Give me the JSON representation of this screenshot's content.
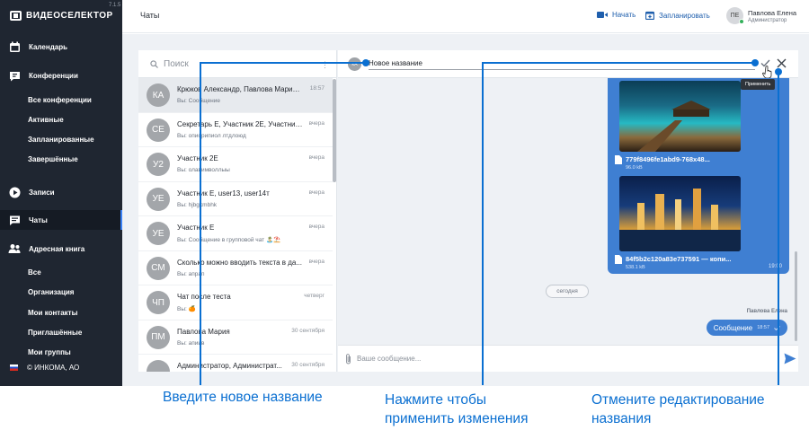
{
  "app": {
    "logo_text": "ВИДЕОСЕЛЕКТОР",
    "version": "7.1.5",
    "copyright": "© ИНКОМА, АО"
  },
  "sidebar": {
    "sections": [
      {
        "label": "Календарь",
        "icon": "calendar-icon"
      },
      {
        "label": "Конференции",
        "icon": "conference-icon"
      },
      {
        "label": "Записи",
        "icon": "play-icon"
      },
      {
        "label": "Чаты",
        "icon": "chat-icon",
        "active": true
      },
      {
        "label": "Адресная книга",
        "icon": "contacts-icon"
      }
    ],
    "conference_items": [
      "Все конференции",
      "Активные",
      "Запланированные",
      "Завершённые"
    ],
    "addressbook_items": [
      "Все",
      "Организация",
      "Мои контакты",
      "Приглашённые",
      "Мои группы"
    ]
  },
  "header": {
    "title": "Чаты",
    "start_label": "Начать",
    "schedule_label": "Запланировать",
    "user_initials": "ПЕ",
    "user_name": "Павлова Елена",
    "user_role": "Администратор"
  },
  "chat_list": {
    "search_placeholder": "Поиск",
    "items": [
      {
        "initials": "КА",
        "name": "Крюков Александр, Павлова Мария, ...",
        "time": "18:57",
        "preview": "Вы: Сообщение",
        "selected": true
      },
      {
        "initials": "СЕ",
        "name": "Секретарь Е, Участник 2Е, Участник ...",
        "time": "вчера",
        "preview": "Вы: опиорипиол лтдлоюд"
      },
      {
        "initials": "У2",
        "name": "Участник 2Е",
        "time": "вчера",
        "preview": "Вы: олавимволлыы"
      },
      {
        "initials": "УЕ",
        "name": "Участник Е, user13, user14т",
        "time": "вчера",
        "preview": "Вы: hjbgkmbhk"
      },
      {
        "initials": "УЕ",
        "name": "Участник Е",
        "time": "вчера",
        "preview": "Вы: Сообщение в групповой чат 🏝️⛱️"
      },
      {
        "initials": "СМ",
        "name": "Сколько можно вводить текста в да...",
        "time": "вчера",
        "preview": "Вы: апрап"
      },
      {
        "initials": "ЧП",
        "name": "Чат после теста",
        "time": "четверг",
        "preview": "Вы: 🍊"
      },
      {
        "initials": "ПМ",
        "name": "Павлова Мария",
        "time": "30 сентября",
        "preview": "Вы: апиив"
      },
      {
        "initials": "",
        "name": "Администратор, Администрат...",
        "time": "30 сентября",
        "preview": ""
      }
    ]
  },
  "chat": {
    "avatar_initials": "КА",
    "name_value": "Новое название",
    "apply_tooltip": "Применить",
    "files": [
      {
        "name": "779f8496fe1abd9-768x48...",
        "size": "96.0 kB"
      },
      {
        "name": "84f5b2c120a83e737591 — копи...",
        "size": "538.1 kB"
      }
    ],
    "image_time": "19:00",
    "day_label": "сегодня",
    "sender": "Павлова Елена",
    "last_message": "Сообщение",
    "last_time": "18:57",
    "composer_placeholder": "Ваше сообщение..."
  },
  "callouts": {
    "new_name": "Введите новое название",
    "apply_line1": "Нажмите чтобы",
    "apply_line2": "применить изменения",
    "cancel_line1": "Отмените редактирование",
    "cancel_line2": "названия"
  },
  "colors": {
    "sidebar_bg": "#1f2631",
    "accent": "#3f7fd2",
    "callout": "#0a6fd1",
    "online": "#33b05a"
  }
}
